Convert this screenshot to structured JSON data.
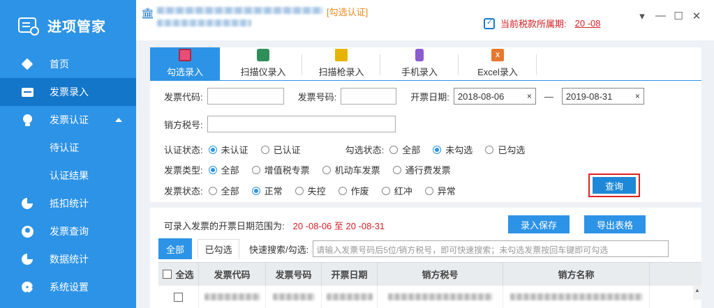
{
  "app": {
    "title": "进项管家"
  },
  "sidebar": {
    "items": [
      {
        "label": "首页",
        "icon": "cube-icon"
      },
      {
        "label": "发票录入",
        "icon": "card-icon",
        "active": true
      },
      {
        "label": "发票认证",
        "icon": "bulb-icon",
        "expanded": true
      },
      {
        "label": "待认证",
        "sub": true
      },
      {
        "label": "认证结果",
        "sub": true
      },
      {
        "label": "抵扣统计",
        "icon": "pie-chart-icon"
      },
      {
        "label": "发票查询",
        "icon": "user-icon"
      },
      {
        "label": "数据统计",
        "icon": "pie-chart-icon"
      },
      {
        "label": "系统设置",
        "icon": "gear-icon"
      }
    ]
  },
  "header": {
    "mode_tag": "[勾选认证]",
    "period_label": "当前税款所属期:",
    "period_value": "20 -08"
  },
  "entry_tabs": [
    {
      "label": "勾选录入",
      "active": true
    },
    {
      "label": "扫描仪录入"
    },
    {
      "label": "扫描枪录入"
    },
    {
      "label": "手机录入"
    },
    {
      "label": "Excel录入"
    }
  ],
  "filters": {
    "invoice_code_label": "发票代码:",
    "invoice_number_label": "发票号码:",
    "invoice_date_label": "开票日期:",
    "date_from": "2018-08-06",
    "date_to": "2019-08-31",
    "date_sep": "—",
    "clear_glyph": "×",
    "seller_tax_label": "销方税号:",
    "cert_status": {
      "label": "认证状态:",
      "options": [
        "未认证",
        "已认证"
      ],
      "selected": 0
    },
    "check_status": {
      "label": "勾选状态:",
      "options": [
        "全部",
        "未勾选",
        "已勾选"
      ],
      "selected": 1
    },
    "invoice_type": {
      "label": "发票类型:",
      "options": [
        "全部",
        "增值税专票",
        "机动车发票",
        "通行费发票"
      ],
      "selected": 0
    },
    "invoice_status": {
      "label": "发票状态:",
      "options": [
        "全部",
        "正常",
        "失控",
        "作废",
        "红冲",
        "异常"
      ],
      "selected": 1
    },
    "query_label": "查询"
  },
  "results": {
    "range_label": "可录入发票的开票日期范围为:",
    "range_value": "20 -08-06 至 20 -08-31",
    "save_label": "录入保存",
    "export_label": "导出表格",
    "tab_all": "全部",
    "tab_checked": "已勾选",
    "quick_search_label": "快速搜索/勾选:",
    "quick_search_placeholder": "请输入发票号码后5位/销方税号，即可快速搜索；未勾选发票按回车键即可勾选",
    "columns": [
      "全选",
      "发票代码",
      "发票号码",
      "开票日期",
      "销方税号",
      "销方名称"
    ]
  },
  "colors": {
    "accent": "#2d93e6",
    "sidebar_active": "#1376c9",
    "alert": "#d21f26",
    "tag": "#e88a1a"
  }
}
